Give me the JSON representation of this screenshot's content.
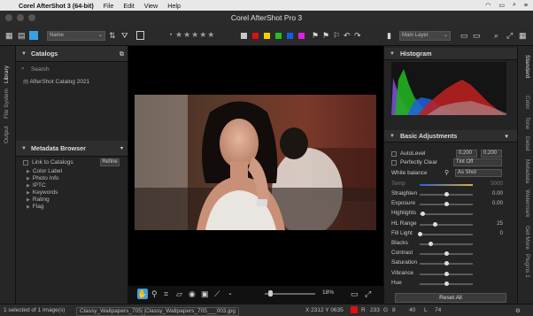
{
  "menubar": {
    "apple": "",
    "app": "Corel AfterShot 3 (64-bit)",
    "items": [
      "File",
      "Edit",
      "View",
      "Help"
    ],
    "right": [
      "wifi-icon",
      "battery-icon",
      "search-icon",
      "menu-icon"
    ]
  },
  "window": {
    "title": "Corel AfterShot Pro 3"
  },
  "toolbar": {
    "sort_select": "Name",
    "stars": "★★★★★",
    "color_labels": [
      "#c8c8c8",
      "#e01010",
      "#f0d000",
      "#20c020",
      "#1060e0",
      "#e020e0"
    ],
    "layer_select": "Main Layer"
  },
  "left_tabs": [
    "Library",
    "File System",
    "Output"
  ],
  "catalogs": {
    "title": "Catalogs",
    "search_placeholder": "Search",
    "items": [
      "AfterShot Catalog 2021"
    ]
  },
  "metadata": {
    "title": "Metadata Browser",
    "link_label": "Link to Catalogs",
    "refine_label": "Refine",
    "items": [
      "Color Label",
      "Photo Info",
      "IPTC",
      "Keywords",
      "Rating",
      "Flag"
    ]
  },
  "viewer": {
    "zoom": "18%",
    "zoom_level": 0.18
  },
  "histogram": {
    "title": "Histogram"
  },
  "basic": {
    "title": "Basic Adjustments",
    "autolevel": {
      "label": "AutoLevel",
      "v1": "0.200",
      "v2": "0.200"
    },
    "perfectly_clear": {
      "label": "Perfectly Clear",
      "value": "Tint Off"
    },
    "white_balance": {
      "label": "White balance",
      "value": "As Shot"
    },
    "temp": {
      "label": "Temp",
      "value": "5000"
    },
    "sliders": [
      {
        "label": "Straighten",
        "value": "0.00",
        "pos": 0.5
      },
      {
        "label": "Exposure",
        "value": "0.00",
        "pos": 0.5
      },
      {
        "label": "Highlights",
        "value": "",
        "pos": 0.05
      },
      {
        "label": "HL Range",
        "value": "25",
        "pos": 0.28
      },
      {
        "label": "Fill Light",
        "value": "0",
        "pos": 0.0
      },
      {
        "label": "Blacks",
        "value": "",
        "pos": 0.2
      },
      {
        "label": "Contrast",
        "value": "",
        "pos": 0.5
      },
      {
        "label": "Saturation",
        "value": "",
        "pos": 0.5
      },
      {
        "label": "Vibrance",
        "value": "",
        "pos": 0.5
      },
      {
        "label": "Hue",
        "value": "",
        "pos": 0.5
      }
    ],
    "reset_label": "Reset All"
  },
  "right_tabs": [
    "Standard",
    "Color",
    "Tone",
    "Detail",
    "Metadata",
    "Watermark",
    "Get More",
    "Plugins 1"
  ],
  "status": {
    "selected": "1 selected of 1 image(s)",
    "tab1": "Classy_Wallpapers_705",
    "tab2": "Classy_Wallpapers_705___003.jpg",
    "coords": "X 2312  Y 0635",
    "r_label": "R",
    "r_val": "233",
    "g_label": "G",
    "g_val": "8",
    "l_label": "40",
    "l_val": "L",
    "lum": "74"
  }
}
